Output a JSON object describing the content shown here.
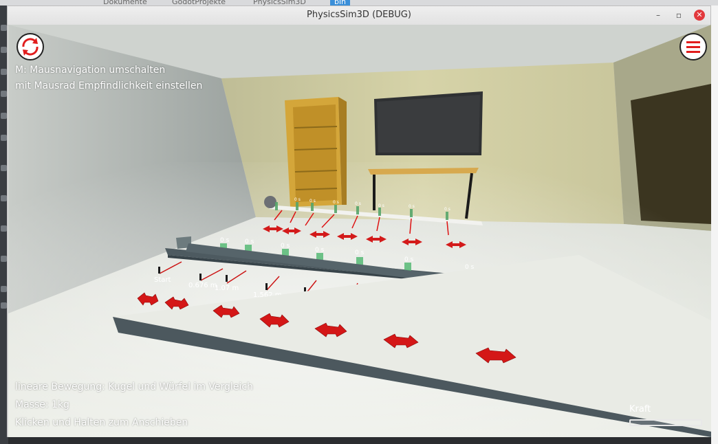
{
  "desktop": {
    "tabs": [
      "Dokumente",
      "GodotProjekte",
      "PhysicsSim3D",
      "bin"
    ]
  },
  "window": {
    "title": "PhysicsSim3D (DEBUG)",
    "minimize": "–",
    "maximize": "▫",
    "close": "✕"
  },
  "hud": {
    "nav_hint_line1": "M: Mausnavigation umschalten",
    "nav_hint_line2": "mit Mausrad Empfindlichkeit einstellen",
    "scene_title": "lineare Bewegung: Kugel und Würfel im Vergleich",
    "mass": "Masse: 1kg",
    "instruction": "Klicken und Halten zum Anschieben",
    "force_label": "Kraft",
    "force_level": 0
  },
  "track_labels": {
    "time_top": [
      "0 s",
      "0 s",
      "0 s",
      "0 s",
      "0 s",
      "0 s"
    ],
    "time_mid": [
      "0 s",
      "0 s",
      "0 s",
      "0 s",
      "0 s",
      "0 s"
    ],
    "distance": [
      "Start",
      "0.676 m",
      "1.07 m",
      "1.562 m",
      "2.176 m",
      "2.726 m",
      "3.326 m",
      "4.2 m"
    ]
  },
  "colors": {
    "accent": "#e11d1d",
    "wall": "#c8c59a",
    "floor": "#e4e6e0"
  }
}
